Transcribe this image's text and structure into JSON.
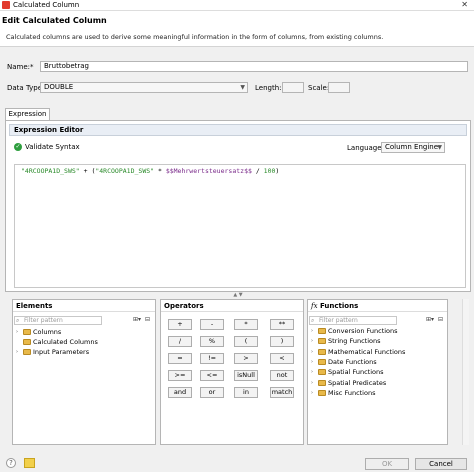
{
  "window": {
    "title": "Calculated Column",
    "close_glyph": "✕"
  },
  "header": {
    "title": "Edit Calculated Column",
    "description": "Calculated columns are used to derive some meaningful information in the form of columns, from existing columns."
  },
  "form": {
    "name_label": "Name:*",
    "name_value": "Bruttobetrag",
    "datatype_label": "Data Type:",
    "datatype_value": "DOUBLE",
    "length_label": "Length:",
    "length_value": "",
    "scale_label": "Scale:",
    "scale_value": ""
  },
  "tabs": [
    {
      "label": "Expression"
    }
  ],
  "expression_editor": {
    "title": "Expression Editor",
    "validate_label": "Validate Syntax",
    "language_label": "Language:",
    "language_value": "Column Engine",
    "expression_parts": {
      "a": "\"4RCOOPA1D_SWS\"",
      "op1": " + (",
      "b": "\"4RCOOPA1D_SWS\"",
      "op2": " * ",
      "c": "$$Mehrwertsteuersatz$$",
      "op3": " / ",
      "d": "100",
      "op4": ")"
    }
  },
  "elements_panel": {
    "title": "Elements",
    "filter_placeholder": "Filter pattern",
    "items": [
      {
        "label": "Columns"
      },
      {
        "label": "Calculated Columns"
      },
      {
        "label": "Input Parameters"
      }
    ]
  },
  "operators_panel": {
    "title": "Operators",
    "rows": [
      [
        "+",
        "-",
        "*",
        "**"
      ],
      [
        "/",
        "%",
        "(",
        ")"
      ],
      [
        "=",
        "!=",
        ">",
        "<"
      ],
      [
        ">=",
        "<=",
        "isNull",
        "not"
      ],
      [
        "and",
        "or",
        "in",
        "match"
      ]
    ]
  },
  "functions_panel": {
    "title": "Functions",
    "fx": "fx",
    "filter_placeholder": "Filter pattern",
    "items": [
      {
        "label": "Conversion Functions"
      },
      {
        "label": "String Functions"
      },
      {
        "label": "Mathematical Functions"
      },
      {
        "label": "Date Functions"
      },
      {
        "label": "Spatial Functions"
      },
      {
        "label": "Spatial Predicates"
      },
      {
        "label": "Misc Functions"
      }
    ]
  },
  "footer": {
    "ok_label": "OK",
    "cancel_label": "Cancel",
    "help_glyph": "?"
  },
  "colors": {
    "string_literal": "#2a8a2a",
    "parameter": "#7a2a8a",
    "validate_ok": "#2e9e3e"
  }
}
